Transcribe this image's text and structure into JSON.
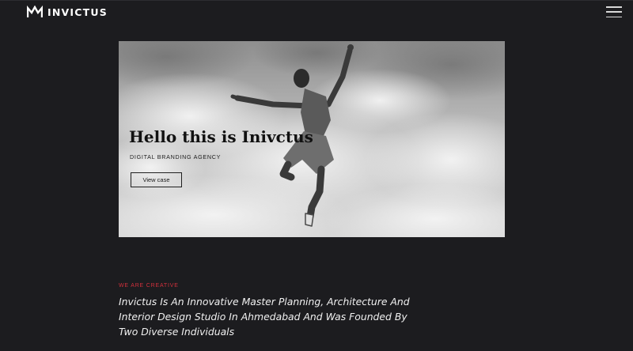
{
  "header": {
    "brand": "INVICTUS",
    "logo_icon": "invictus-crown-logo-icon",
    "menu_icon": "hamburger-menu-icon"
  },
  "hero": {
    "title": "Hello this is Inivctus",
    "subtitle": "DIGITAL BRANDING AGENCY",
    "cta_label": "View case",
    "image": "black-and-white photo of a man jumping against a cloudy sky"
  },
  "intro": {
    "eyebrow": "WE ARE CREATIVE",
    "text": "Invictus Is An Innovative Master Planning, Architecture And Interior Design Studio In Ahmedabad And Was Founded By Two Diverse Individuals"
  },
  "colors": {
    "background": "#1c1c1f",
    "accent": "#d2303c",
    "text": "#f1f1f1"
  }
}
